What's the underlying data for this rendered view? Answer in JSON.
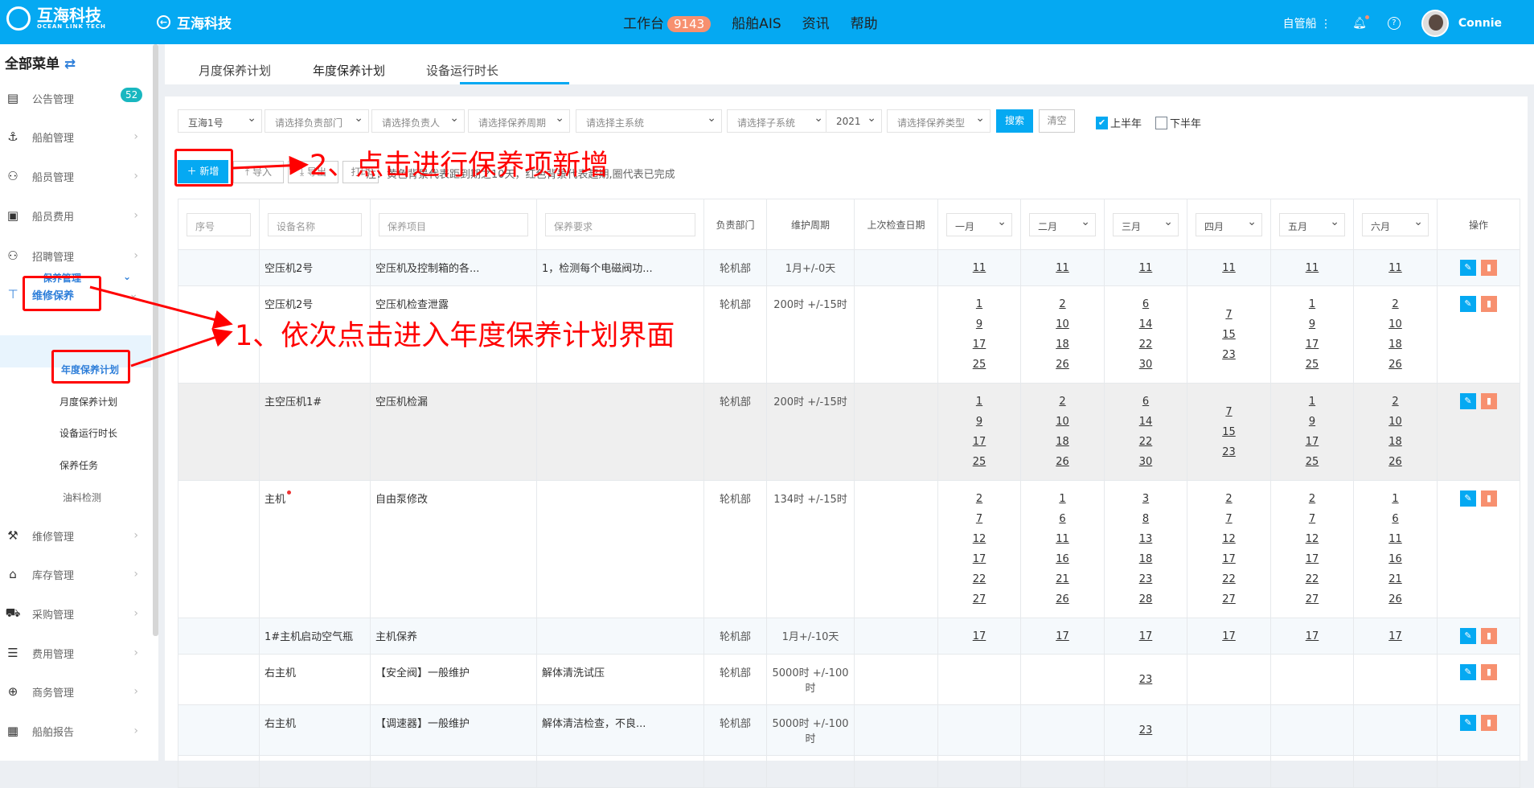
{
  "header": {
    "brand": "互海科技",
    "brand_sub": "OCEAN LINK TECH",
    "back_title": "互海科技",
    "nav": [
      {
        "label": "工作台",
        "badge": "9143"
      },
      {
        "label": "船舶AIS"
      },
      {
        "label": "资讯"
      },
      {
        "label": "帮助"
      }
    ],
    "ship_mode": "自管船",
    "user": "Connie",
    "color": "#05a9f2"
  },
  "sidebar": {
    "title": "全部菜单",
    "items": [
      {
        "label": "公告管理",
        "icon": "book-icon",
        "badge": "52"
      },
      {
        "label": "船舶管理",
        "icon": "anchor-icon"
      },
      {
        "label": "船员管理",
        "icon": "person-icon"
      },
      {
        "label": "船员费用",
        "icon": "wallet-icon"
      },
      {
        "label": "招聘管理",
        "icon": "recruit-icon"
      },
      {
        "label": "维修保养",
        "icon": "hammer-icon"
      },
      {
        "label": "油料检测"
      },
      {
        "label": "维修管理",
        "icon": "wrench-icon"
      },
      {
        "label": "库存管理",
        "icon": "house-icon"
      },
      {
        "label": "采购管理",
        "icon": "cart-icon"
      },
      {
        "label": "费用管理",
        "icon": "database-icon"
      },
      {
        "label": "商务管理",
        "icon": "globe-icon"
      },
      {
        "label": "船舶报告",
        "icon": "calendar-icon"
      }
    ],
    "submenu": "保养管理",
    "subitems": [
      "年度保养计划",
      "月度保养计划",
      "设备运行时长",
      "保养任务"
    ]
  },
  "tabs": [
    "月度保养计划",
    "年度保养计划",
    "设备运行时长"
  ],
  "filters": {
    "ship": "互海1号",
    "dept": "请选择负责部门",
    "person": "请选择负责人",
    "cycle": "请选择保养周期",
    "main_sys": "请选择主系统",
    "sub_sys": "请选择子系统",
    "year": "2021",
    "type": "请选择保养类型",
    "search": "搜索",
    "clear": "清空",
    "first_half": "上半年",
    "second_half": "下半年"
  },
  "toolbar": {
    "add": "新增",
    "import": "导入",
    "export": "导出",
    "print": "打印",
    "note": "注：黄色背景代表距到期之10天，红色背景代表超期,圈代表已完成"
  },
  "table": {
    "headers": {
      "no": "序号",
      "equipment": "设备名称",
      "item": "保养项目",
      "req": "保养要求",
      "dept": "负责部门",
      "cycle": "维护周期",
      "last": "上次检查日期",
      "months": [
        "一月",
        "二月",
        "三月",
        "四月",
        "五月",
        "六月"
      ],
      "op": "操作"
    },
    "rows": [
      {
        "equipment": "空压机2号",
        "item": "空压机及控制箱的各...",
        "req": "1，检测每个电磁阀功...",
        "dept": "轮机部",
        "cycle": "1月+/-0天",
        "months": [
          [
            "11"
          ],
          [
            "11"
          ],
          [
            "11"
          ],
          [
            "11"
          ],
          [
            "11"
          ],
          [
            "11"
          ]
        ]
      },
      {
        "equipment": "空压机2号",
        "item": "空压机检查泄露",
        "req": "",
        "dept": "轮机部",
        "cycle": "200时 +/-15时",
        "months": [
          [
            "1",
            "9",
            "17",
            "25"
          ],
          [
            "2",
            "10",
            "18",
            "26"
          ],
          [
            "6",
            "14",
            "22",
            "30"
          ],
          [
            "7",
            "15",
            "23"
          ],
          [
            "1",
            "9",
            "17",
            "25"
          ],
          [
            "2",
            "10",
            "18",
            "26"
          ]
        ]
      },
      {
        "equipment": "主空压机1#",
        "item": "空压机检漏",
        "req": "",
        "dept": "轮机部",
        "cycle": "200时 +/-15时",
        "months": [
          [
            "1",
            "9",
            "17",
            "25"
          ],
          [
            "2",
            "10",
            "18",
            "26"
          ],
          [
            "6",
            "14",
            "22",
            "30"
          ],
          [
            "7",
            "15",
            "23"
          ],
          [
            "1",
            "9",
            "17",
            "25"
          ],
          [
            "2",
            "10",
            "18",
            "26"
          ]
        ]
      },
      {
        "equipment": "主机",
        "flag": true,
        "item": "自由泵修改",
        "req": "",
        "dept": "轮机部",
        "cycle": "134时 +/-15时",
        "months": [
          [
            "2",
            "7",
            "12",
            "17",
            "22",
            "27"
          ],
          [
            "1",
            "6",
            "11",
            "16",
            "21",
            "26"
          ],
          [
            "3",
            "8",
            "13",
            "18",
            "23",
            "28"
          ],
          [
            "2",
            "7",
            "12",
            "17",
            "22",
            "27"
          ],
          [
            "2",
            "7",
            "12",
            "17",
            "22",
            "27"
          ],
          [
            "1",
            "6",
            "11",
            "16",
            "21",
            "26"
          ]
        ]
      },
      {
        "equipment": "1#主机启动空气瓶",
        "item": "主机保养",
        "req": "",
        "dept": "轮机部",
        "cycle": "1月+/-10天",
        "months": [
          [
            "17"
          ],
          [
            "17"
          ],
          [
            "17"
          ],
          [
            "17"
          ],
          [
            "17"
          ],
          [
            "17"
          ]
        ]
      },
      {
        "equipment": "右主机",
        "item": "【安全阀】一般维护",
        "req": "解体清洗试压",
        "dept": "轮机部",
        "cycle": "5000时 +/-100时",
        "months": [
          [],
          [],
          [
            "23"
          ],
          [],
          [],
          []
        ]
      },
      {
        "equipment": "右主机",
        "item": "【调速器】一般维护",
        "req": "解体清洁检查，不良...",
        "dept": "轮机部",
        "cycle": "5000时 +/-100时",
        "months": [
          [],
          [],
          [
            "23"
          ],
          [],
          [],
          []
        ]
      }
    ]
  },
  "annotations": {
    "step1": "1、依次点击进入年度保养计划界面",
    "step2": "2、点击进行保养项新增",
    "color": "#ff0000"
  }
}
